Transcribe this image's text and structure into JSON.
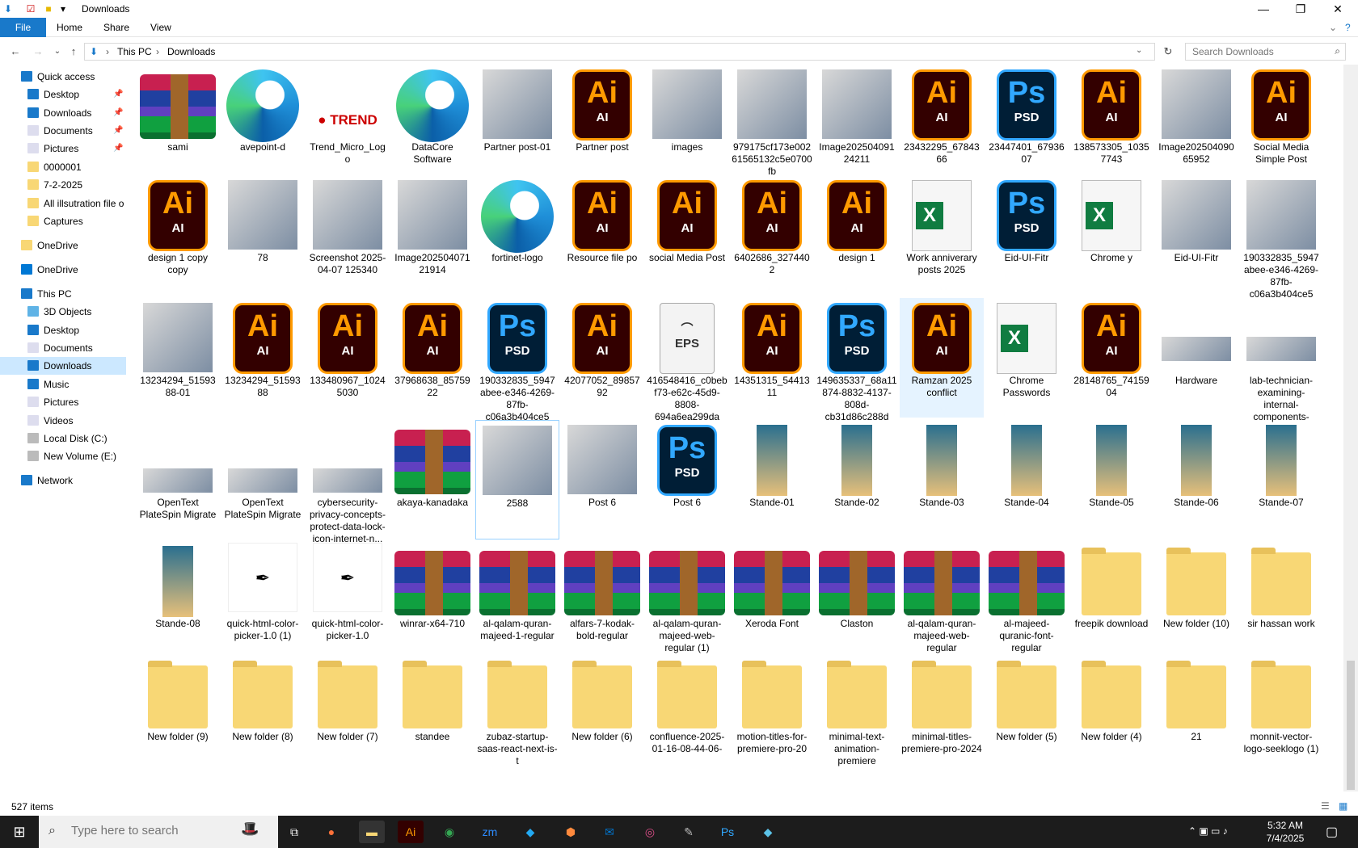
{
  "window": {
    "title": "Downloads",
    "minimize": "—",
    "maximize": "❐",
    "close": "✕"
  },
  "ribbon": {
    "tabs": [
      "File",
      "Home",
      "Share",
      "View"
    ]
  },
  "address": {
    "crumbs": [
      "This PC",
      "Downloads"
    ],
    "sep": "›"
  },
  "search": {
    "placeholder": "Search Downloads"
  },
  "nav": {
    "items": [
      {
        "label": "Quick access"
      },
      {
        "label": "Desktop"
      },
      {
        "label": "Downloads"
      },
      {
        "label": "Documents"
      },
      {
        "label": "Pictures"
      },
      {
        "label": "0000001"
      },
      {
        "label": "7-2-2025"
      },
      {
        "label": "All illsutration file o"
      },
      {
        "label": "Captures"
      },
      {
        "label": "OneDrive"
      },
      {
        "label": "OneDrive"
      },
      {
        "label": "This PC"
      },
      {
        "label": "3D Objects"
      },
      {
        "label": "Desktop"
      },
      {
        "label": "Documents"
      },
      {
        "label": "Downloads"
      },
      {
        "label": "Music"
      },
      {
        "label": "Pictures"
      },
      {
        "label": "Videos"
      },
      {
        "label": "Local Disk (C:)"
      },
      {
        "label": "New Volume (E:)"
      },
      {
        "label": "Network"
      }
    ]
  },
  "files": [
    [
      "sami",
      "avepoint-d",
      "Trend_Micro_Logo",
      "DataCore Software",
      "Partner post-01",
      "Partner post",
      "images",
      "979175cf173e00261565132c5e0700fb",
      "Image20250409124211",
      "23432295_6784366",
      "23447401_6793607",
      "138573305_10357743",
      "Image20250409065952",
      "Social Media Simple Post"
    ],
    [
      "design 1 copy copy",
      "78",
      "Screenshot 2025-04-07 125340",
      "Image20250407121914",
      "fortinet-logo",
      "Resource file po",
      "social Media Post",
      "6402686_3274402",
      "design 1",
      "Work anniverary posts 2025",
      "Eid-UI-Fitr",
      "Chrome y",
      "Eid-UI-Fitr",
      "190332835_5947abee-e346-4269-87fb-c06a3b404ce5"
    ],
    [
      "13234294_5159388-01",
      "13234294_5159388",
      "133480967_10245030",
      "37968638_8575922",
      "190332835_5947abee-e346-4269-87fb-c06a3b404ce5",
      "42077052_8985792",
      "416548416_c0bebf73-e62c-45d9-8808-694a6ea299da",
      "14351315_5441311",
      "149635337_68a11874-8832-4137-808d-cb31d86c288d",
      "Ramzan 2025 conflict",
      "Chrome Passwords",
      "28148765_7415904",
      "Hardware",
      "lab-technician-examining-internal-components-smart-device-us..."
    ],
    [
      "OpenText PlateSpin Migrate",
      "OpenText PlateSpin Migrate",
      "cybersecurity-privacy-concepts-protect-data-lock-icon-internet-n...",
      "akaya-kanadaka",
      "2588",
      "Post 6",
      "Post 6",
      "Stande-01",
      "Stande-02",
      "Stande-03",
      "Stande-04",
      "Stande-05",
      "Stande-06",
      "Stande-07"
    ],
    [
      "Stande-08",
      "quick-html-color-picker-1.0 (1)",
      "quick-html-color-picker-1.0",
      "winrar-x64-710",
      "al-qalam-quran-majeed-1-regular",
      "alfars-7-kodak-bold-regular",
      "al-qalam-quran-majeed-web-regular (1)",
      "Xeroda Font",
      "Claston",
      "al-qalam-quran-majeed-web-regular",
      "al-majeed-quranic-font-regular",
      "freepik download",
      "New folder (10)",
      "sir hassan work"
    ],
    [
      "New folder (9)",
      "New folder (8)",
      "New folder (7)",
      "standee",
      "zubaz-startup-saas-react-next-is-t",
      "New folder (6)",
      "confluence-2025-01-16-08-44-06-",
      "motion-titles-for-premiere-pro-20",
      "minimal-text-animation-premiere",
      "minimal-titles-premiere-pro-2024",
      "New folder (5)",
      "New folder (4)",
      "21",
      "monnit-vector-logo-seeklogo (1)"
    ]
  ],
  "file_types": [
    [
      "rar",
      "edge",
      "logo",
      "edge",
      "img",
      "ai",
      "img",
      "img",
      "img",
      "ai",
      "ps",
      "ai",
      "img",
      "ai"
    ],
    [
      "ai",
      "img",
      "img",
      "img",
      "edge",
      "ai",
      "ai",
      "ai",
      "ai",
      "xl",
      "ps",
      "xl",
      "img",
      "img"
    ],
    [
      "img",
      "ai",
      "ai",
      "ai",
      "ps",
      "ai",
      "eps",
      "ai",
      "ps",
      "ai",
      "xl",
      "ai",
      "img",
      "img"
    ],
    [
      "img",
      "img",
      "img",
      "rar",
      "img",
      "img",
      "ps",
      "banner",
      "banner",
      "banner",
      "banner",
      "banner",
      "banner",
      "banner"
    ],
    [
      "banner",
      "picker",
      "picker",
      "rar",
      "rar",
      "rar",
      "rar",
      "rar",
      "rar",
      "rar",
      "rar",
      "folder",
      "folder",
      "folder"
    ],
    [
      "folder",
      "folder",
      "folder",
      "folder",
      "folder",
      "folder",
      "folder",
      "folder",
      "folder",
      "folder",
      "folder",
      "folder",
      "folder",
      "folder"
    ]
  ],
  "status": {
    "count": "527 items"
  },
  "taskbar": {
    "search_placeholder": "Type here to search",
    "time": "5:32 AM",
    "date": "7/4/2025"
  },
  "colors": {
    "accent": "#1979ca",
    "selection": "#cce8ff",
    "ai_orange": "#ff9a00",
    "ps_blue": "#31a8ff"
  }
}
